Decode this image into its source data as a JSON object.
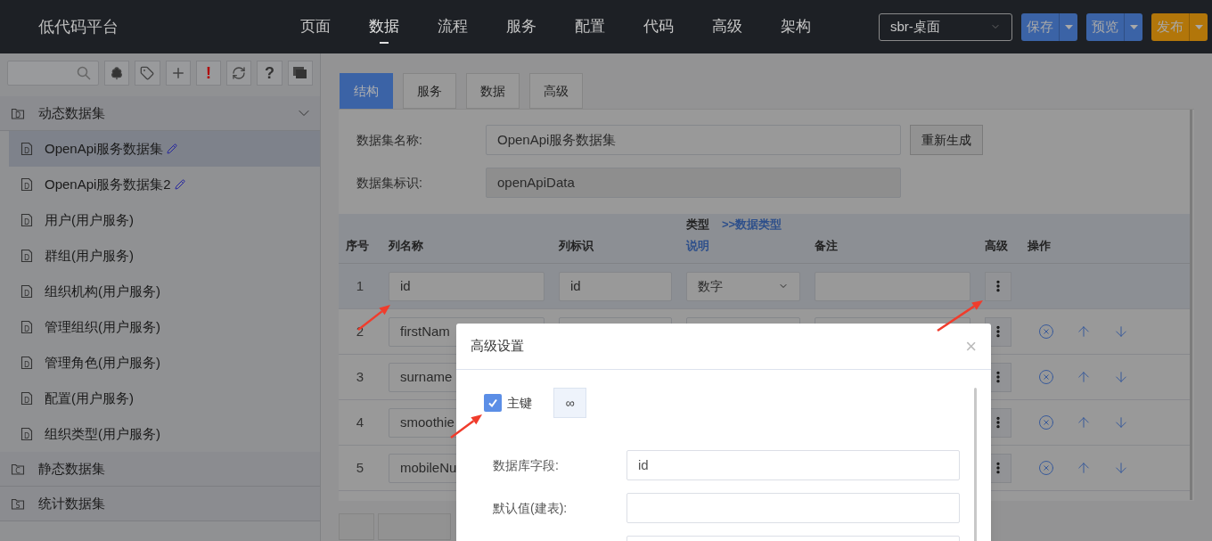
{
  "header": {
    "logo": "低代码平台",
    "nav": [
      {
        "label": "页面",
        "selected": false
      },
      {
        "label": "数据",
        "selected": true
      },
      {
        "label": "流程",
        "selected": false
      },
      {
        "label": "服务",
        "selected": false
      },
      {
        "label": "配置",
        "selected": false
      },
      {
        "label": "代码",
        "selected": false
      },
      {
        "label": "高级",
        "selected": false
      },
      {
        "label": "架构",
        "selected": false
      }
    ],
    "app_select": {
      "value": "sbr-桌面"
    },
    "buttons": [
      {
        "label": "保存",
        "kind": "primary"
      },
      {
        "label": "预览",
        "kind": "primary"
      },
      {
        "label": "发布",
        "kind": "warning"
      }
    ]
  },
  "sidebar": {
    "toolbar": [
      {
        "kind": "tree"
      },
      {
        "kind": "tag"
      },
      {
        "kind": "plus"
      },
      {
        "kind": "text",
        "text": "!",
        "color": "#b00000"
      },
      {
        "kind": "refresh"
      },
      {
        "kind": "text",
        "text": "?",
        "color": "#333333"
      },
      {
        "kind": "windows"
      }
    ],
    "groups": [
      {
        "label": "动态数据集",
        "icon_letter": "D",
        "expanded": true,
        "items": [
          {
            "label": "OpenApi服务数据集",
            "icon_letter": "D",
            "editable": true,
            "selected": true
          },
          {
            "label": "OpenApi服务数据集2",
            "icon_letter": "D",
            "editable": true,
            "selected": false
          },
          {
            "label": "用户(用户服务)",
            "icon_letter": "D",
            "editable": false,
            "selected": false
          },
          {
            "label": "群组(用户服务)",
            "icon_letter": "D",
            "editable": false,
            "selected": false
          },
          {
            "label": "组织机构(用户服务)",
            "icon_letter": "D",
            "editable": false,
            "selected": false
          },
          {
            "label": "管理组织(用户服务)",
            "icon_letter": "D",
            "editable": false,
            "selected": false
          },
          {
            "label": "管理角色(用户服务)",
            "icon_letter": "D",
            "editable": false,
            "selected": false
          },
          {
            "label": "配置(用户服务)",
            "icon_letter": "D",
            "editable": false,
            "selected": false
          },
          {
            "label": "组织类型(用户服务)",
            "icon_letter": "D",
            "editable": false,
            "selected": false
          }
        ]
      },
      {
        "label": "静态数据集",
        "icon_letter": "C",
        "expanded": false
      },
      {
        "label": "统计数据集",
        "icon_letter": "S",
        "expanded": false
      }
    ]
  },
  "main": {
    "tabs": [
      {
        "label": "结构",
        "selected": true
      },
      {
        "label": "服务",
        "selected": false
      },
      {
        "label": "数据",
        "selected": false
      },
      {
        "label": "高级",
        "selected": false
      }
    ],
    "form": [
      {
        "label": "数据集名称:",
        "value": "OpenApi服务数据集",
        "disabled": false,
        "action": "重新生成"
      },
      {
        "label": "数据集标识:",
        "value": "openApiData",
        "disabled": true
      }
    ],
    "table": {
      "columns": [
        {
          "label": "序号"
        },
        {
          "label": "列名称"
        },
        {
          "label": "列标识"
        },
        {
          "label": "类型",
          "sublabel": "说明",
          "link": ">>数据类型"
        },
        {
          "label": "备注"
        },
        {
          "label": "高级"
        },
        {
          "label": "操作"
        }
      ],
      "rows": [
        {
          "index": "1",
          "name": "id",
          "key": "id",
          "type": "数字",
          "selected": true,
          "actions": false
        },
        {
          "index": "2",
          "name": "firstNam",
          "selected": false,
          "actions": true
        },
        {
          "index": "3",
          "name": "surname",
          "selected": false,
          "actions": true
        },
        {
          "index": "4",
          "name": "smoothie",
          "selected": false,
          "actions": true
        },
        {
          "index": "5",
          "name": "mobileNu",
          "selected": false,
          "actions": true
        }
      ]
    }
  },
  "modal": {
    "title": "高级设置",
    "close": "×",
    "primary_key": {
      "label": "主键",
      "checked": true
    },
    "link_button": "∞",
    "fields": [
      {
        "kind": "text",
        "label": "数据库字段:",
        "value": "id"
      },
      {
        "kind": "text",
        "label": "默认值(建表):"
      },
      {
        "kind": "text"
      }
    ]
  }
}
